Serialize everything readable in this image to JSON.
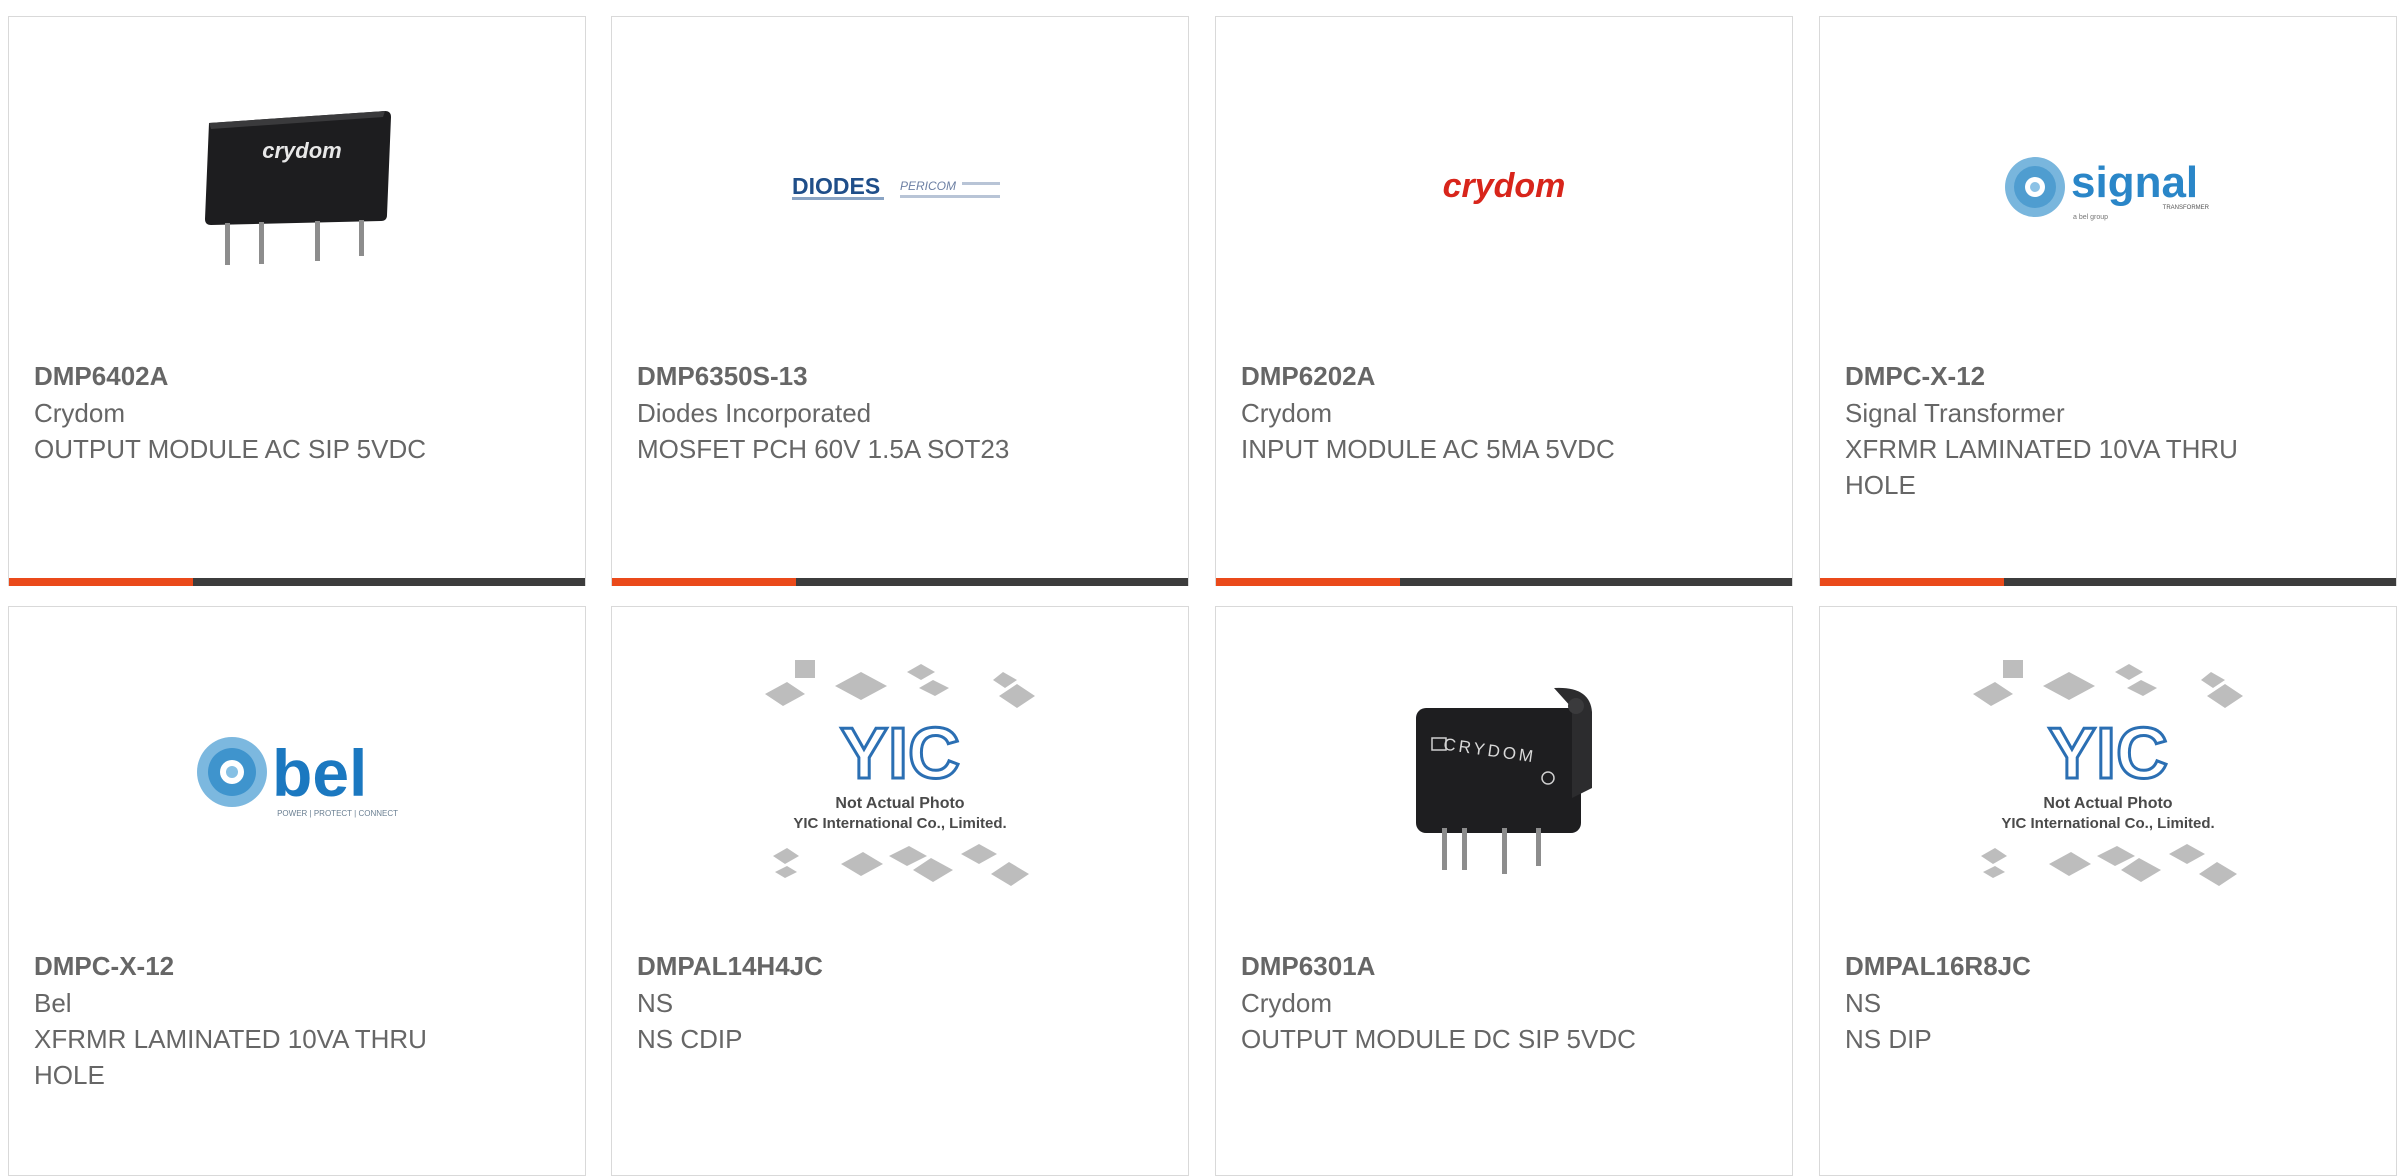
{
  "colors": {
    "accent": "#ea4a1a",
    "bar": "#3c3c3c",
    "text": "#666666",
    "border": "#d9d9d9"
  },
  "products": [
    {
      "part": "DMP6402A",
      "maker": "Crydom",
      "desc": "OUTPUT MODULE AC SIP 5VDC",
      "image": "crydom-sip-relay-photo",
      "logo_text": "crydom"
    },
    {
      "part": "DMP6350S-13",
      "maker": "Diodes Incorporated",
      "desc": "MOSFET PCH 60V 1.5A SOT23",
      "image": "diodes-pericom-logo",
      "logo_text": "DIODES",
      "logo_text2": "PERICOM"
    },
    {
      "part": "DMP6202A",
      "maker": "Crydom",
      "desc": "INPUT MODULE AC 5MA 5VDC",
      "image": "crydom-logo",
      "logo_text": "crydom"
    },
    {
      "part": "DMPC-X-12",
      "maker": "Signal Transformer",
      "desc": "XFRMR LAMINATED 10VA THRU HOLE",
      "image": "signal-transformer-logo",
      "logo_text": "signal",
      "logo_sub": "TRANSFORMER",
      "logo_sub2": "a bel group"
    },
    {
      "part": "DMPC-X-12",
      "maker": "Bel",
      "desc": "XFRMR LAMINATED 10VA THRU HOLE",
      "image": "bel-logo",
      "logo_text": "bel",
      "logo_sub": "POWER | PROTECT | CONNECT"
    },
    {
      "part": "DMPAL14H4JC",
      "maker": "NS",
      "desc": "NS CDIP",
      "image": "yic-placeholder",
      "logo_text": "YIC",
      "note1": "Not Actual Photo",
      "note2": "YIC International Co., Limited."
    },
    {
      "part": "DMP6301A",
      "maker": "Crydom",
      "desc": "OUTPUT MODULE DC SIP 5VDC",
      "image": "crydom-dc-relay-photo",
      "logo_text": "CRYDOM"
    },
    {
      "part": "DMPAL16R8JC",
      "maker": "NS",
      "desc": "NS DIP",
      "image": "yic-placeholder",
      "logo_text": "YIC",
      "note1": "Not Actual Photo",
      "note2": "YIC International Co., Limited."
    }
  ]
}
